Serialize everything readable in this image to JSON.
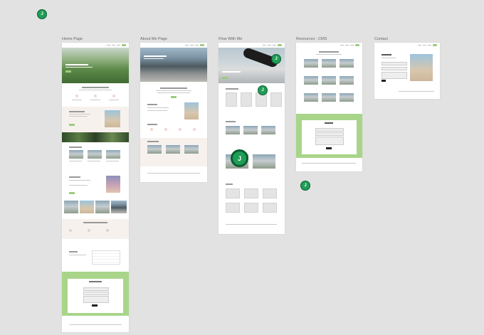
{
  "frames": [
    {
      "id": "home",
      "label": "Home Page"
    },
    {
      "id": "about",
      "label": "About Me Page"
    },
    {
      "id": "flow",
      "label": "Flow With Me"
    },
    {
      "id": "resources",
      "label": "Resources - CMS"
    },
    {
      "id": "contact",
      "label": "Contact"
    }
  ],
  "cursor": {
    "initial": "J"
  },
  "colors": {
    "canvas": "#e2e2e2",
    "accent_green": "#a9d58a",
    "cursor_green": "#1e9e57"
  }
}
